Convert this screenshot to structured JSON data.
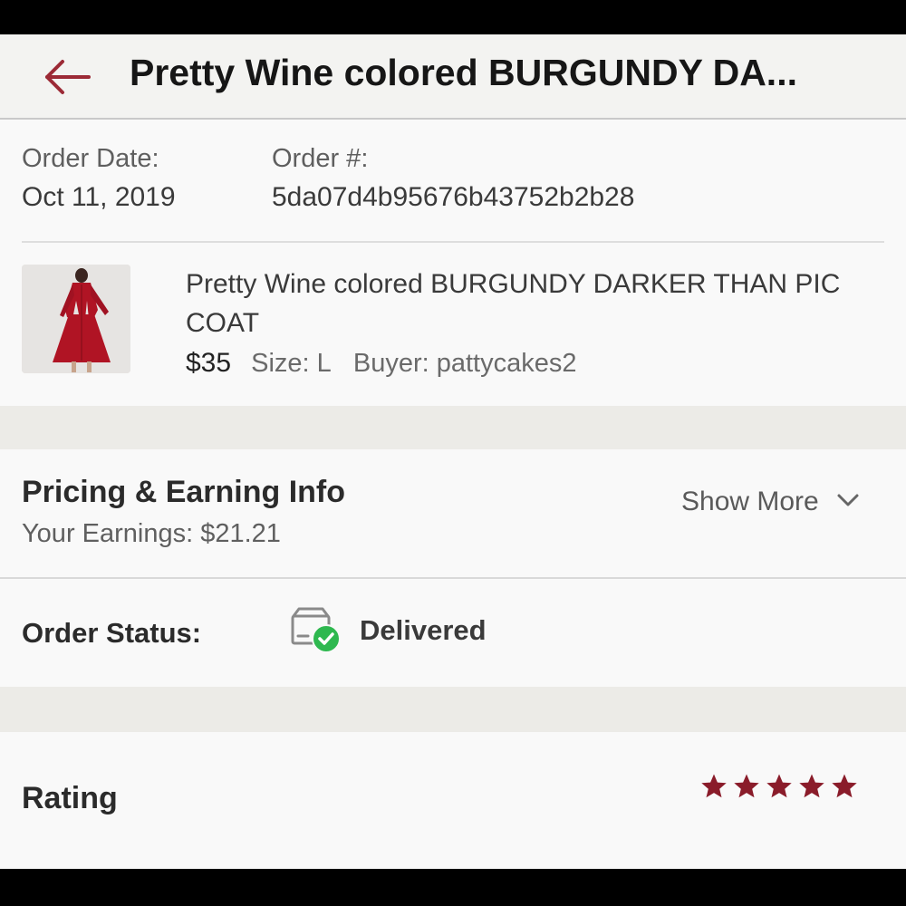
{
  "header": {
    "title": "Pretty Wine colored BURGUNDY DA..."
  },
  "order": {
    "date_label": "Order Date:",
    "date_value": "Oct 11, 2019",
    "number_label": "Order #:",
    "number_value": "5da07d4b95676b43752b2b28"
  },
  "item": {
    "title": "Pretty Wine colored BURGUNDY DARKER THAN PIC COAT",
    "price": "$35",
    "size": "Size: L",
    "buyer": "Buyer: pattycakes2"
  },
  "pricing": {
    "heading": "Pricing & Earning Info",
    "show_more": "Show More",
    "earnings": "Your Earnings: $21.21"
  },
  "status": {
    "label": "Order Status:",
    "value": "Delivered"
  },
  "rating": {
    "label": "Rating",
    "stars": 5,
    "max_stars": 5
  },
  "colors": {
    "accent": "#9c2a36",
    "star": "#8a1c2a",
    "success": "#2eb84f"
  },
  "icons": {
    "back": "arrow-left-icon",
    "chevron": "chevron-down-icon",
    "status": "package-delivered-icon",
    "star": "star-icon"
  }
}
